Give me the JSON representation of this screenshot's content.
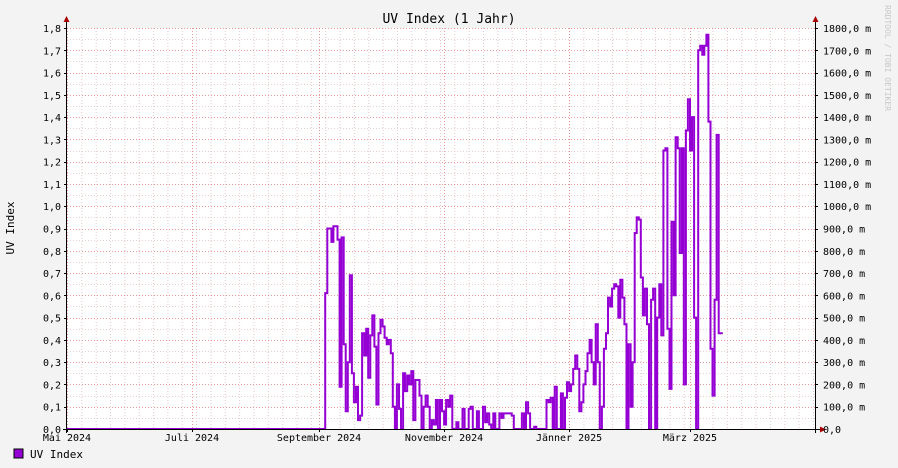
{
  "chart_data": {
    "type": "line",
    "title": "UV Index (1 Jahr)",
    "ylabel": "UV Index",
    "watermark": "RRDTOOL / TOBI OETIKER",
    "legend": [
      {
        "name": "UV Index",
        "color": "#9400d3"
      }
    ],
    "ylim": [
      0,
      1.8
    ],
    "left_ticks": [
      "0,0",
      "0,1",
      "0,2",
      "0,3",
      "0,4",
      "0,5",
      "0,6",
      "0,7",
      "0,8",
      "0,9",
      "1,0",
      "1,1",
      "1,2",
      "1,3",
      "1,4",
      "1,5",
      "1,6",
      "1,7",
      "1,8"
    ],
    "right_ticks": [
      "0,0",
      "100,0 m",
      "200,0 m",
      "300,0 m",
      "400,0 m",
      "500,0 m",
      "600,0 m",
      "700,0 m",
      "800,0 m",
      "900,0 m",
      "1000,0 m",
      "1100,0 m",
      "1200,0 m",
      "1300,0 m",
      "1400,0 m",
      "1500,0 m",
      "1600,0 m",
      "1700,0 m",
      "1800,0 m"
    ],
    "x_range_days": [
      0,
      365
    ],
    "x_ticks": [
      {
        "label": "Mai 2024",
        "day": 0
      },
      {
        "label": "Juli 2024",
        "day": 61
      },
      {
        "label": "September 2024",
        "day": 123
      },
      {
        "label": "November 2024",
        "day": 184
      },
      {
        "label": "Jänner 2025",
        "day": 245
      },
      {
        "label": "März 2025",
        "day": 304
      }
    ],
    "series": [
      {
        "name": "UV Index",
        "color": "#9400d3",
        "points": [
          [
            0,
            0
          ],
          [
            124,
            0
          ],
          [
            126,
            0.61
          ],
          [
            127,
            0.9
          ],
          [
            129,
            0.84
          ],
          [
            130,
            0.91
          ],
          [
            132,
            0.85
          ],
          [
            133,
            0.19
          ],
          [
            134,
            0.86
          ],
          [
            135,
            0.38
          ],
          [
            136,
            0.08
          ],
          [
            137,
            0.3
          ],
          [
            138,
            0.69
          ],
          [
            139,
            0.25
          ],
          [
            140,
            0.12
          ],
          [
            141,
            0.19
          ],
          [
            142,
            0.04
          ],
          [
            143,
            0.06
          ],
          [
            144,
            0.43
          ],
          [
            145,
            0.33
          ],
          [
            146,
            0.45
          ],
          [
            147,
            0.23
          ],
          [
            148,
            0.42
          ],
          [
            149,
            0.51
          ],
          [
            150,
            0.37
          ],
          [
            151,
            0.11
          ],
          [
            152,
            0.43
          ],
          [
            153,
            0.49
          ],
          [
            154,
            0.46
          ],
          [
            155,
            0.41
          ],
          [
            156,
            0.38
          ],
          [
            157,
            0.4
          ],
          [
            158,
            0.34
          ],
          [
            159,
            0.1
          ],
          [
            160,
            0.0
          ],
          [
            161,
            0.2
          ],
          [
            162,
            0.09
          ],
          [
            163,
            0.0
          ],
          [
            164,
            0.25
          ],
          [
            165,
            0.17
          ],
          [
            166,
            0.24
          ],
          [
            167,
            0.2
          ],
          [
            168,
            0.26
          ],
          [
            169,
            0.04
          ],
          [
            170,
            0.22
          ],
          [
            171,
            0.22
          ],
          [
            172,
            0.15
          ],
          [
            173,
            0.0
          ],
          [
            174,
            0.1
          ],
          [
            175,
            0.15
          ],
          [
            176,
            0.1
          ],
          [
            177,
            0.0
          ],
          [
            178,
            0.04
          ],
          [
            179,
            0.02
          ],
          [
            180,
            0.13
          ],
          [
            181,
            0.0
          ],
          [
            182,
            0.13
          ],
          [
            183,
            0.08
          ],
          [
            184,
            0.02
          ],
          [
            185,
            0.13
          ],
          [
            186,
            0.1
          ],
          [
            187,
            0.15
          ],
          [
            188,
            0.0
          ],
          [
            190,
            0.03
          ],
          [
            191,
            0.0
          ],
          [
            193,
            0.09
          ],
          [
            194,
            0.0
          ],
          [
            196,
            0.09
          ],
          [
            197,
            0.1
          ],
          [
            198,
            0.0
          ],
          [
            200,
            0.08
          ],
          [
            201,
            0.0
          ],
          [
            203,
            0.1
          ],
          [
            204,
            0.03
          ],
          [
            205,
            0.07
          ],
          [
            206,
            0.02
          ],
          [
            207,
            0.0
          ],
          [
            208,
            0.07
          ],
          [
            209,
            0.0
          ],
          [
            211,
            0.07
          ],
          [
            212,
            0.05
          ],
          [
            213,
            0.07
          ],
          [
            217,
            0.06
          ],
          [
            218,
            0.0
          ],
          [
            222,
            0.07
          ],
          [
            223,
            0.0
          ],
          [
            224,
            0.12
          ],
          [
            225,
            0.07
          ],
          [
            226,
            0.0
          ],
          [
            228,
            0.01
          ],
          [
            229,
            0.0
          ],
          [
            234,
            0.13
          ],
          [
            235,
            0.12
          ],
          [
            236,
            0.14
          ],
          [
            237,
            0.0
          ],
          [
            238,
            0.19
          ],
          [
            239,
            0.0
          ],
          [
            241,
            0.16
          ],
          [
            242,
            0.0
          ],
          [
            243,
            0.14
          ],
          [
            244,
            0.21
          ],
          [
            245,
            0.17
          ],
          [
            246,
            0.2
          ],
          [
            247,
            0.27
          ],
          [
            248,
            0.33
          ],
          [
            249,
            0.27
          ],
          [
            250,
            0.08
          ],
          [
            251,
            0.12
          ],
          [
            252,
            0.2
          ],
          [
            253,
            0.26
          ],
          [
            254,
            0.34
          ],
          [
            255,
            0.4
          ],
          [
            256,
            0.3
          ],
          [
            257,
            0.2
          ],
          [
            258,
            0.47
          ],
          [
            259,
            0.3
          ],
          [
            260,
            0.0
          ],
          [
            261,
            0.1
          ],
          [
            262,
            0.36
          ],
          [
            263,
            0.43
          ],
          [
            264,
            0.59
          ],
          [
            265,
            0.55
          ],
          [
            266,
            0.63
          ],
          [
            267,
            0.65
          ],
          [
            268,
            0.64
          ],
          [
            269,
            0.5
          ],
          [
            270,
            0.67
          ],
          [
            271,
            0.59
          ],
          [
            272,
            0.47
          ],
          [
            273,
            0.0
          ],
          [
            274,
            0.38
          ],
          [
            275,
            0.1
          ],
          [
            276,
            0.3
          ],
          [
            277,
            0.88
          ],
          [
            278,
            0.95
          ],
          [
            279,
            0.94
          ],
          [
            280,
            0.68
          ],
          [
            281,
            0.51
          ],
          [
            282,
            0.63
          ],
          [
            283,
            0.47
          ],
          [
            284,
            0.0
          ],
          [
            285,
            0.58
          ],
          [
            286,
            0.63
          ],
          [
            287,
            0.0
          ],
          [
            288,
            0.5
          ],
          [
            289,
            0.65
          ],
          [
            290,
            0.42
          ],
          [
            291,
            1.25
          ],
          [
            292,
            1.26
          ],
          [
            293,
            0.45
          ],
          [
            294,
            0.18
          ],
          [
            295,
            0.93
          ],
          [
            296,
            0.6
          ],
          [
            297,
            1.31
          ],
          [
            298,
            1.26
          ],
          [
            299,
            0.79
          ],
          [
            300,
            1.26
          ],
          [
            301,
            0.2
          ],
          [
            302,
            1.34
          ],
          [
            303,
            1.48
          ],
          [
            304,
            1.25
          ],
          [
            305,
            1.4
          ],
          [
            306,
            0.5
          ],
          [
            307,
            0.0
          ],
          [
            308,
            1.7
          ],
          [
            309,
            1.72
          ],
          [
            310,
            1.68
          ],
          [
            311,
            1.72
          ],
          [
            312,
            1.77
          ],
          [
            313,
            1.38
          ],
          [
            314,
            0.36
          ],
          [
            315,
            0.15
          ],
          [
            316,
            0.58
          ],
          [
            317,
            1.32
          ],
          [
            318,
            0.43
          ],
          [
            319,
            0.43
          ]
        ]
      }
    ]
  }
}
